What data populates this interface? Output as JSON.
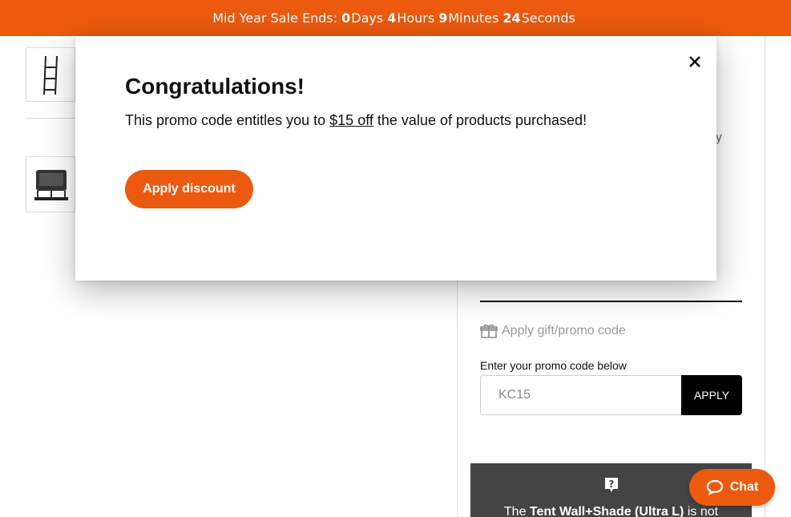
{
  "banner": {
    "prefix": "Mid Year Sale Ends:",
    "days_value": "0",
    "days_label": "Days",
    "hours_value": "4",
    "hours_label": "Hours",
    "minutes_value": "9",
    "minutes_label": "Minutes",
    "seconds_value": "24",
    "seconds_label": "Seconds",
    "color": "#ec5a0f"
  },
  "thumbnails": [
    {
      "icon": "ladder-image"
    },
    {
      "icon": "trampoline-image"
    }
  ],
  "panel": {
    "fragment_text": "y",
    "gift_label": "Apply gift/promo code",
    "gift_icon": "gift-icon",
    "promo_label": "Enter your promo code below",
    "promo_value": "KC15",
    "apply_label": "APPLY"
  },
  "notice": {
    "icon": "question-icon",
    "text_prefix": "The",
    "product_name": "Tent Wall+Shade (Ultra L)",
    "text_suffix": "is not"
  },
  "chat": {
    "label": "Chat",
    "icon": "chat-bubble-icon",
    "color": "#ec5a0f"
  },
  "modal": {
    "title": "Congratulations!",
    "body_prefix": "This promo code entitles you to",
    "amount": "$15 off",
    "body_suffix": "the value of products purchased!",
    "button_label": "Apply discount",
    "close_icon": "close-icon"
  }
}
